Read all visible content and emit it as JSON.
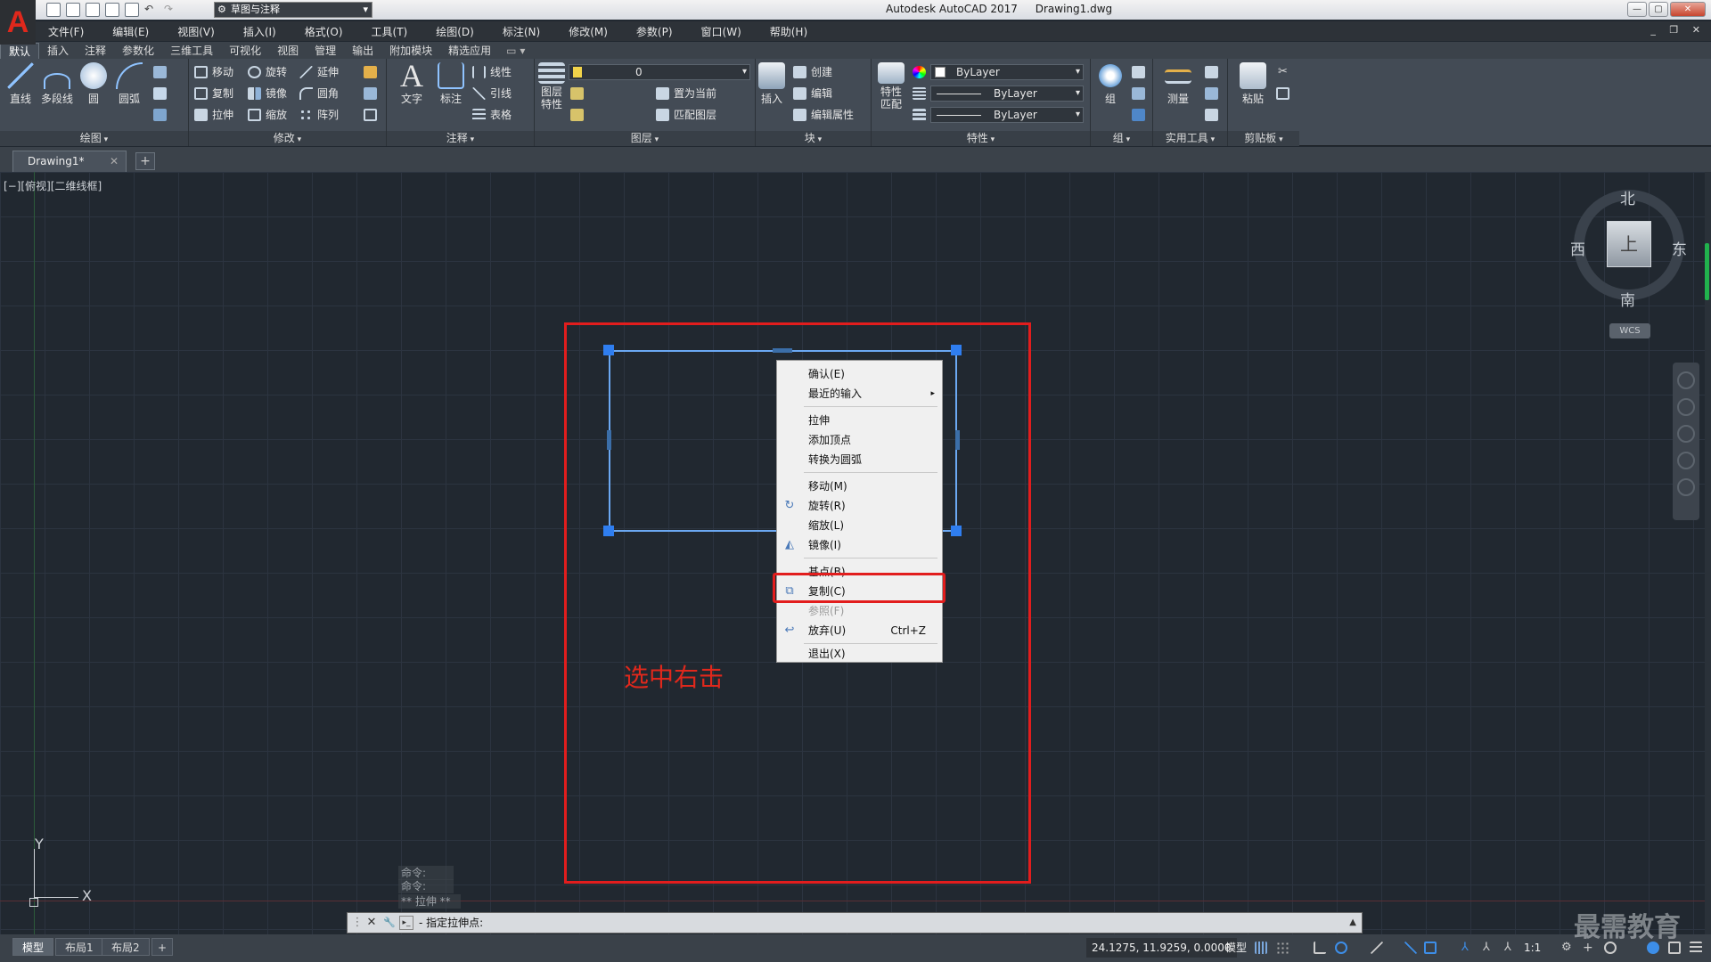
{
  "app": {
    "logo_letter": "A",
    "workspace": "草图与注释",
    "product": "Autodesk AutoCAD 2017",
    "document": "Drawing1.dwg"
  },
  "window": {
    "minimize": "—",
    "maximize": "▢",
    "close": "✕",
    "mdi": "_ ❐ ✕"
  },
  "menu": [
    "文件(F)",
    "编辑(E)",
    "视图(V)",
    "插入(I)",
    "格式(O)",
    "工具(T)",
    "绘图(D)",
    "标注(N)",
    "修改(M)",
    "参数(P)",
    "窗口(W)",
    "帮助(H)"
  ],
  "ribbon_tabs": [
    "默认",
    "插入",
    "注释",
    "参数化",
    "三维工具",
    "可视化",
    "视图",
    "管理",
    "输出",
    "附加模块",
    "精选应用",
    "▭ ▾"
  ],
  "ribbon": {
    "draw": {
      "title": "绘图",
      "line": "直线",
      "polyline": "多段线",
      "circle": "圆",
      "arc": "圆弧"
    },
    "modify": {
      "title": "修改",
      "move": "移动",
      "rotate": "旋转",
      "trim": "延伸",
      "copy": "复制",
      "mirror": "镜像",
      "fillet": "圆角",
      "stretch": "拉伸",
      "scale": "缩放",
      "array": "阵列"
    },
    "annotation": {
      "title": "注释",
      "text": "文字",
      "dimension": "标注",
      "linear": "线性",
      "leader": "引线",
      "table": "表格"
    },
    "layers": {
      "title": "图层",
      "properties": "图层\n特性",
      "current_layer": "0",
      "set_current": "置为当前",
      "match_layer": "匹配图层"
    },
    "block": {
      "title": "块",
      "insert": "插入",
      "create": "创建",
      "edit": "编辑",
      "edit_attr": "编辑属性"
    },
    "properties": {
      "title": "特性",
      "match": "特性\n匹配",
      "color": "ByLayer",
      "linetype": "ByLayer",
      "lineweight": "ByLayer"
    },
    "groups": {
      "title": "组",
      "group": "组"
    },
    "utilities": {
      "title": "实用工具",
      "measure": "测量"
    },
    "clipboard": {
      "title": "剪贴板",
      "paste": "粘贴"
    }
  },
  "file_tabs": {
    "active": "Drawing1*",
    "close": "✕",
    "new": "+"
  },
  "viewport": {
    "label": "[−][俯视][二维线框]"
  },
  "viewcube": {
    "north": "北",
    "south": "南",
    "east": "东",
    "west": "西",
    "face": "上",
    "wcs": "WCS"
  },
  "ucs": {
    "x": "X",
    "y": "Y"
  },
  "annotation_text": "选中右击",
  "context_menu": [
    {
      "label": "确认(E)"
    },
    {
      "label": "最近的输入",
      "submenu": "▸"
    },
    {
      "label": "拉伸",
      "highlighted": true
    },
    {
      "label": "添加顶点"
    },
    {
      "label": "转换为圆弧"
    },
    {
      "label": "移动(M)"
    },
    {
      "label": "旋转(R)",
      "icon": "rotate-icon"
    },
    {
      "label": "缩放(L)"
    },
    {
      "label": "镜像(I)",
      "icon": "mirror-icon"
    },
    {
      "label": "基点(B)"
    },
    {
      "label": "复制(C)",
      "icon": "copy-icon"
    },
    {
      "label": "参照(F)",
      "disabled": true
    },
    {
      "label": "放弃(U)",
      "shortcut": "Ctrl+Z",
      "icon": "undo-icon"
    },
    {
      "label": "退出(X)"
    }
  ],
  "command_history": [
    "命令:",
    "命令:",
    "** 拉伸 **"
  ],
  "command_line": {
    "prompt": "- 指定拉伸点:",
    "close": "✕",
    "tools": "🔧",
    "up": "▲"
  },
  "status": {
    "layouts": [
      "模型",
      "布局1",
      "布局2"
    ],
    "add_layout": "+",
    "coords": "24.1275, 11.9259, 0.0000",
    "mode": "模型",
    "scale": "1:1"
  },
  "watermark": "最需教育",
  "colors": {
    "accent_red": "#e21d1d",
    "selection_blue": "#6ba8f2",
    "grip_blue": "#2f7ef0",
    "canvas_bg": "#212830"
  }
}
